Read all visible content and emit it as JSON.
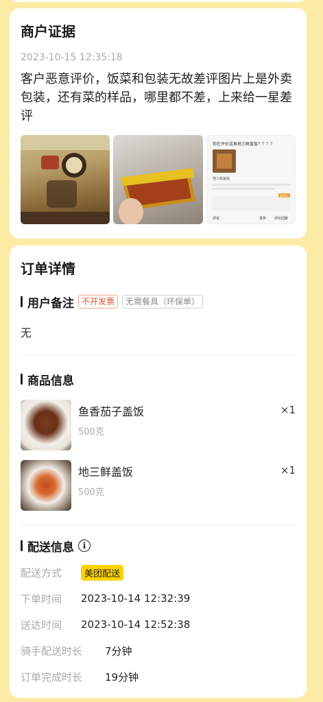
{
  "evidence": {
    "title": "商户证据",
    "timestamp": "2023-10-15 12:35:18",
    "complaint": "客户恶意评价，饭菜和包装无故差评图片上是外卖包装，还有菜的样品，哪里都不差，上来给一星差评",
    "photos": [
      {
        "name": "evidence-photo-packaging"
      },
      {
        "name": "evidence-photo-food-box"
      },
      {
        "name": "evidence-photo-screenshot",
        "lines": [
          "你在评价这鱼地三鲜盖饭？？？？",
          "地三鲜盖饭",
          "去评价",
          "评论",
          "发布",
          "评价回复"
        ]
      }
    ]
  },
  "order": {
    "title": "订单详情",
    "remark": {
      "title": "用户备注",
      "tags": [
        "不开发票",
        "无需餐具（环保单）"
      ],
      "text": "无"
    },
    "goods": {
      "title": "商品信息",
      "items": [
        {
          "name": "鱼香茄子盖饭",
          "weight": "500克",
          "qty": "×1"
        },
        {
          "name": "地三鲜盖饭",
          "weight": "500克",
          "qty": "×1"
        }
      ]
    },
    "delivery": {
      "title": "配送信息",
      "method_label": "配送方式",
      "method": "美团配送",
      "rows": [
        {
          "label": "下单时间",
          "value": "2023-10-14 12:32:39"
        },
        {
          "label": "送达时间",
          "value": "2023-10-14 12:52:38"
        },
        {
          "label": "骑手配送时长",
          "value": "7分钟"
        },
        {
          "label": "订单完成时长",
          "value": "19分钟"
        }
      ]
    }
  },
  "colors": {
    "background": "#fbeba4",
    "badge": "#fcd200",
    "tag_red": "#e05533"
  }
}
